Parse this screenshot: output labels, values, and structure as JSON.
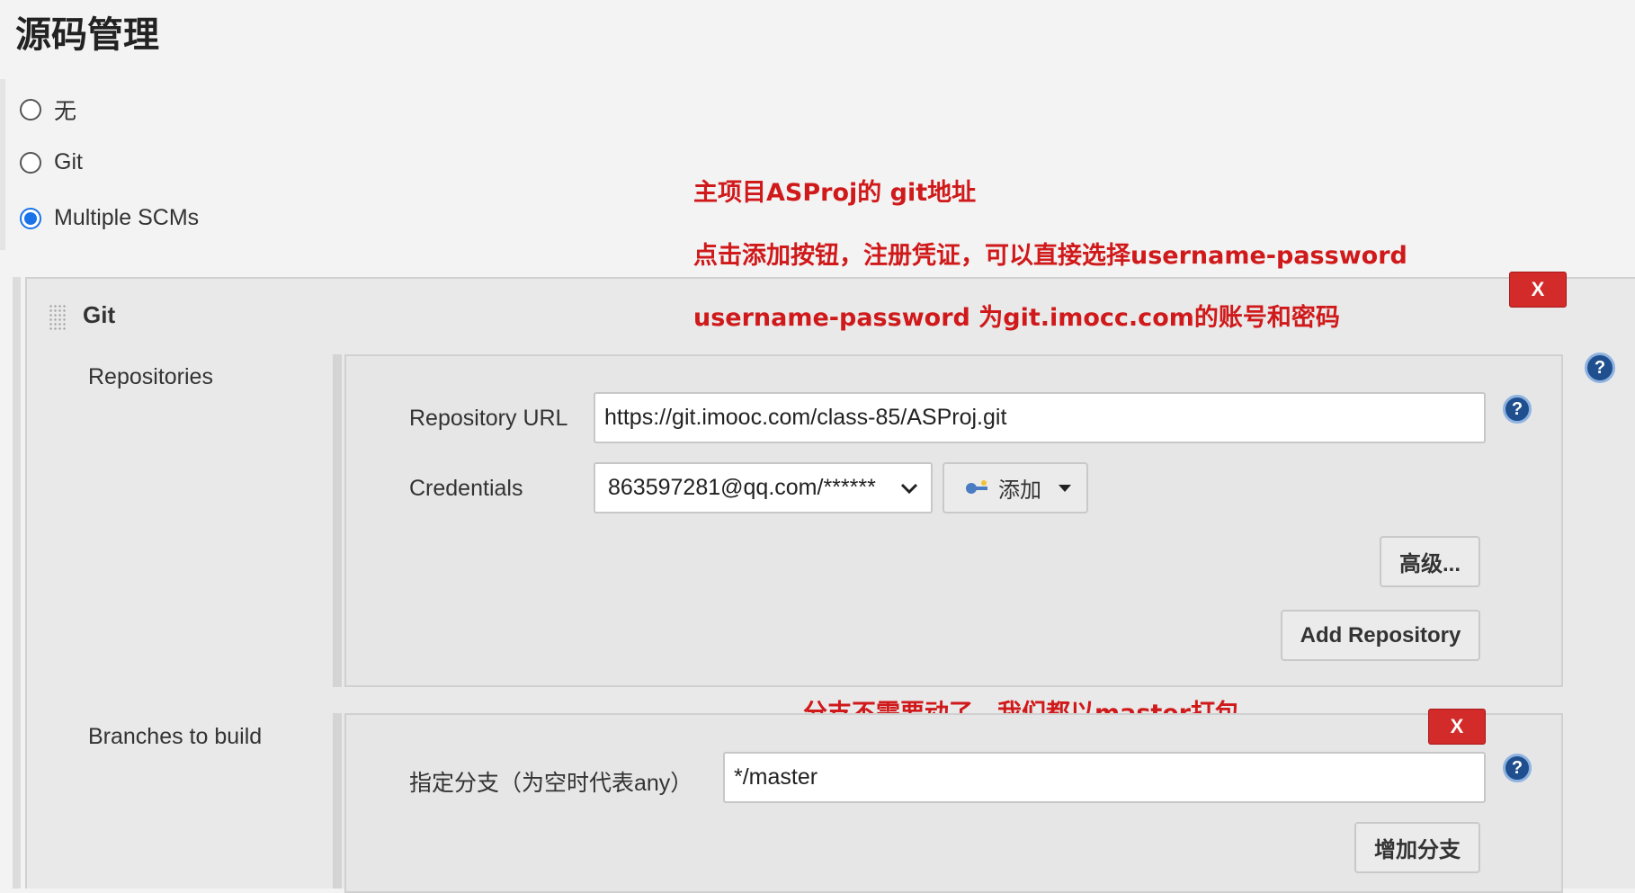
{
  "section": {
    "title": "源码管理"
  },
  "scm_options": [
    {
      "label": "无",
      "checked": false
    },
    {
      "label": "Git",
      "checked": false
    },
    {
      "label": "Multiple SCMs",
      "checked": true
    }
  ],
  "annotations": {
    "main_repo": "主项目ASProj的 git地址",
    "add_credentials": "点击添加按钮，注册凭证，可以直接选择username-password",
    "credential_info": "username-password 为git.imocc.com的账号和密码",
    "branch_note": "分支不需要动了，我们都以master打包"
  },
  "git": {
    "title": "Git",
    "delete_label": "X",
    "help_icon": "?",
    "repositories": {
      "label": "Repositories",
      "url_label": "Repository URL",
      "url_value": "https://git.imooc.com/class-85/ASProj.git",
      "credentials_label": "Credentials",
      "credentials_value": "863597281@qq.com/******",
      "add_button": "添加",
      "advanced_button": "高级...",
      "add_repository_button": "Add Repository"
    },
    "branches": {
      "label": "Branches to build",
      "delete_label": "X",
      "specifier_label": "指定分支（为空时代表any）",
      "specifier_value": "*/master",
      "add_branch_button": "增加分支"
    }
  },
  "colors": {
    "accent": "#1a73e8",
    "annotation": "#d0191a",
    "delete": "#d32a2a",
    "help": "#1f4f8e"
  }
}
